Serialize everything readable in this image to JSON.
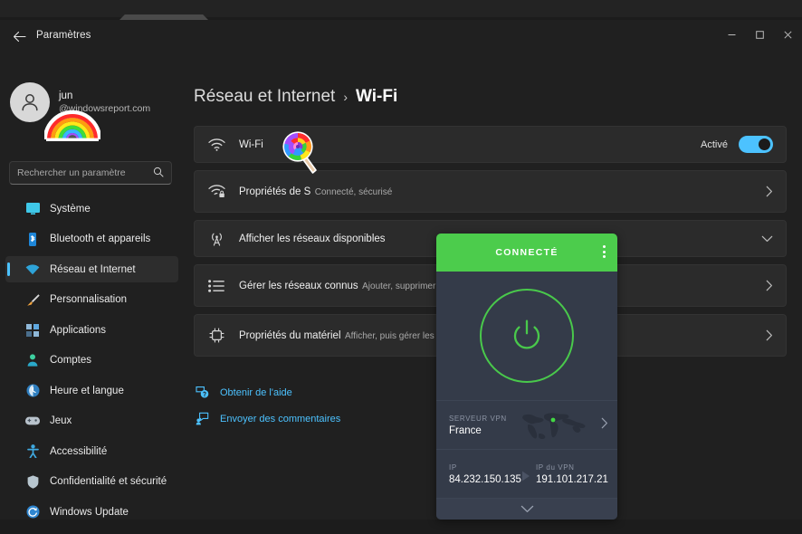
{
  "window": {
    "title": "Paramètres",
    "back_icon": "back-arrow-icon",
    "minimize_label": "—",
    "maximize_label": "□",
    "close_label": "✕"
  },
  "account": {
    "name": "jun",
    "email": "@windowsreport.com",
    "avatar_icon": "person-avatar-icon",
    "sticker_icon": "rainbow-sticker-icon"
  },
  "search": {
    "placeholder": "Rechercher un paramètre",
    "value": "",
    "icon": "search-icon"
  },
  "sidebar": {
    "items": [
      {
        "label": "Système",
        "icon": "system-icon",
        "selected": false
      },
      {
        "label": "Bluetooth et appareils",
        "icon": "bluetooth-icon",
        "selected": false
      },
      {
        "label": "Réseau et Internet",
        "icon": "network-wifi-icon",
        "selected": true
      },
      {
        "label": "Personnalisation",
        "icon": "paintbrush-icon",
        "selected": false
      },
      {
        "label": "Applications",
        "icon": "apps-icon",
        "selected": false
      },
      {
        "label": "Comptes",
        "icon": "accounts-icon",
        "selected": false
      },
      {
        "label": "Heure et langue",
        "icon": "clock-globe-icon",
        "selected": false
      },
      {
        "label": "Jeux",
        "icon": "gamepad-icon",
        "selected": false
      },
      {
        "label": "Accessibilité",
        "icon": "accessibility-icon",
        "selected": false
      },
      {
        "label": "Confidentialité et sécurité",
        "icon": "shield-icon",
        "selected": false
      },
      {
        "label": "Windows Update",
        "icon": "update-icon",
        "selected": false
      }
    ]
  },
  "breadcrumb": {
    "root": "Réseau et Internet",
    "separator": "›",
    "current": "Wi-Fi"
  },
  "settings_rows": [
    {
      "title": "Wi-Fi",
      "subtitle": "",
      "icon": "wifi-icon",
      "state_label": "Activé",
      "control": "toggle",
      "toggle_on": true
    },
    {
      "title": "Propriétés de S",
      "subtitle": "Connecté, sécurisé",
      "icon": "wifi-lock-icon",
      "state_label": "",
      "control": "chevron-right"
    },
    {
      "title": "Afficher les réseaux disponibles",
      "subtitle": "",
      "icon": "antenna-tower-icon",
      "state_label": "",
      "control": "chevron-down"
    },
    {
      "title": "Gérer les réseaux connus",
      "subtitle": "Ajouter, supprimer et modifier des réseaux",
      "icon": "list-icon",
      "state_label": "",
      "control": "chevron-right"
    },
    {
      "title": "Propriétés du matériel",
      "subtitle": "Afficher, puis gérer les propriétés de l'adaptateur Wi-Fi",
      "icon": "chip-icon",
      "state_label": "",
      "control": "chevron-right"
    }
  ],
  "help_links": [
    {
      "label": "Obtenir de l'aide",
      "icon": "help-question-icon"
    },
    {
      "label": "Envoyer des commentaires",
      "icon": "feedback-icon"
    }
  ],
  "vpn_widget": {
    "status": "CONNECTÉ",
    "menu_icon": "kebab-menu-icon",
    "power_icon": "power-button-icon",
    "server_label": "SERVEUR VPN",
    "server_value": "France",
    "map_icon": "world-map-icon",
    "server_chevron_icon": "chevron-right-icon",
    "ip_label": "IP",
    "ip_value": "84.232.150.135",
    "arrow_icon": "arrow-right-icon",
    "vpn_ip_label": "IP du VPN",
    "vpn_ip_value": "191.101.217.21",
    "expand_icon": "chevron-down-icon"
  },
  "cursor": {
    "icon": "lollipop-cursor-icon"
  },
  "colors": {
    "accent_cyan": "#4cc2ff",
    "vpn_green": "#4ccc4c",
    "ring_green": "#49c94b",
    "card_bg": "#2b2b2b",
    "page_bg": "#202020",
    "vpn_panel": "#343b49"
  }
}
